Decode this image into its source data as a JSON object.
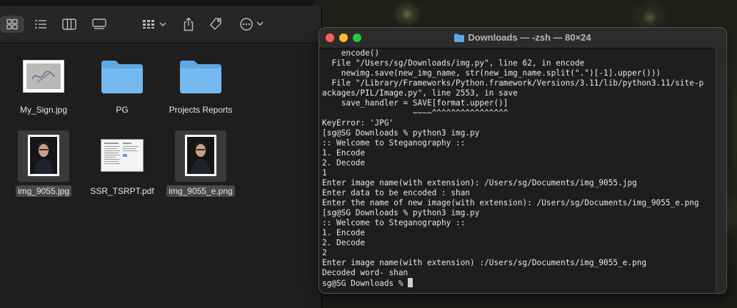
{
  "finder": {
    "toolbar": {
      "icons": [
        "icon-view-grid-icon",
        "list-view-icon",
        "column-view-icon",
        "gallery-view-icon",
        "group-icon",
        "share-icon",
        "tag-icon",
        "more-actions-icon"
      ]
    },
    "files": [
      {
        "name": "My_Sign.jpg",
        "icon": "image-signature-icon",
        "selected": false
      },
      {
        "name": "PG",
        "icon": "folder-icon",
        "selected": false
      },
      {
        "name": "Projects Reports",
        "icon": "folder-icon",
        "selected": false
      },
      {
        "name": "img_9055.jpg",
        "icon": "image-portrait-icon",
        "selected": true
      },
      {
        "name": "SSR_TSRPT.pdf",
        "icon": "pdf-icon",
        "selected": false
      },
      {
        "name": "img_9055_e.png",
        "icon": "image-portrait-icon",
        "selected": true
      }
    ]
  },
  "terminal": {
    "title": "Downloads — -zsh — 80×24",
    "colors": {
      "close": "#ff5f57",
      "minimize": "#febc2e",
      "zoom": "#28c840"
    },
    "lines": [
      "    encode()",
      "  File \"/Users/sg/Downloads/img.py\", line 62, in encode",
      "    newimg.save(new_img_name, str(new_img_name.split(\".\")[-1].upper()))",
      "  File \"/Library/Frameworks/Python.framework/Versions/3.11/lib/python3.11/site-p",
      "ackages/PIL/Image.py\", line 2553, in save",
      "    save_handler = SAVE[format.upper()]",
      "                   ~~~~^^^^^^^^^^^^^^^^",
      "KeyError: 'JPG'",
      "[sg@SG Downloads % python3 img.py",
      ":: Welcome to Steganography ::",
      "1. Encode",
      "2. Decode",
      "1",
      "Enter image name(with extension): /Users/sg/Documents/img_9055.jpg",
      "Enter data to be encoded : shan",
      "Enter the name of new image(with extension): /Users/sg/Documents/img_9055_e.png",
      "[sg@SG Downloads % python3 img.py",
      ":: Welcome to Steganography ::",
      "1. Encode",
      "2. Decode",
      "2",
      "Enter image name(with extension) :/Users/sg/Documents/img_9055_e.png",
      "Decoded word- shan"
    ],
    "prompt": "sg@SG Downloads % "
  }
}
